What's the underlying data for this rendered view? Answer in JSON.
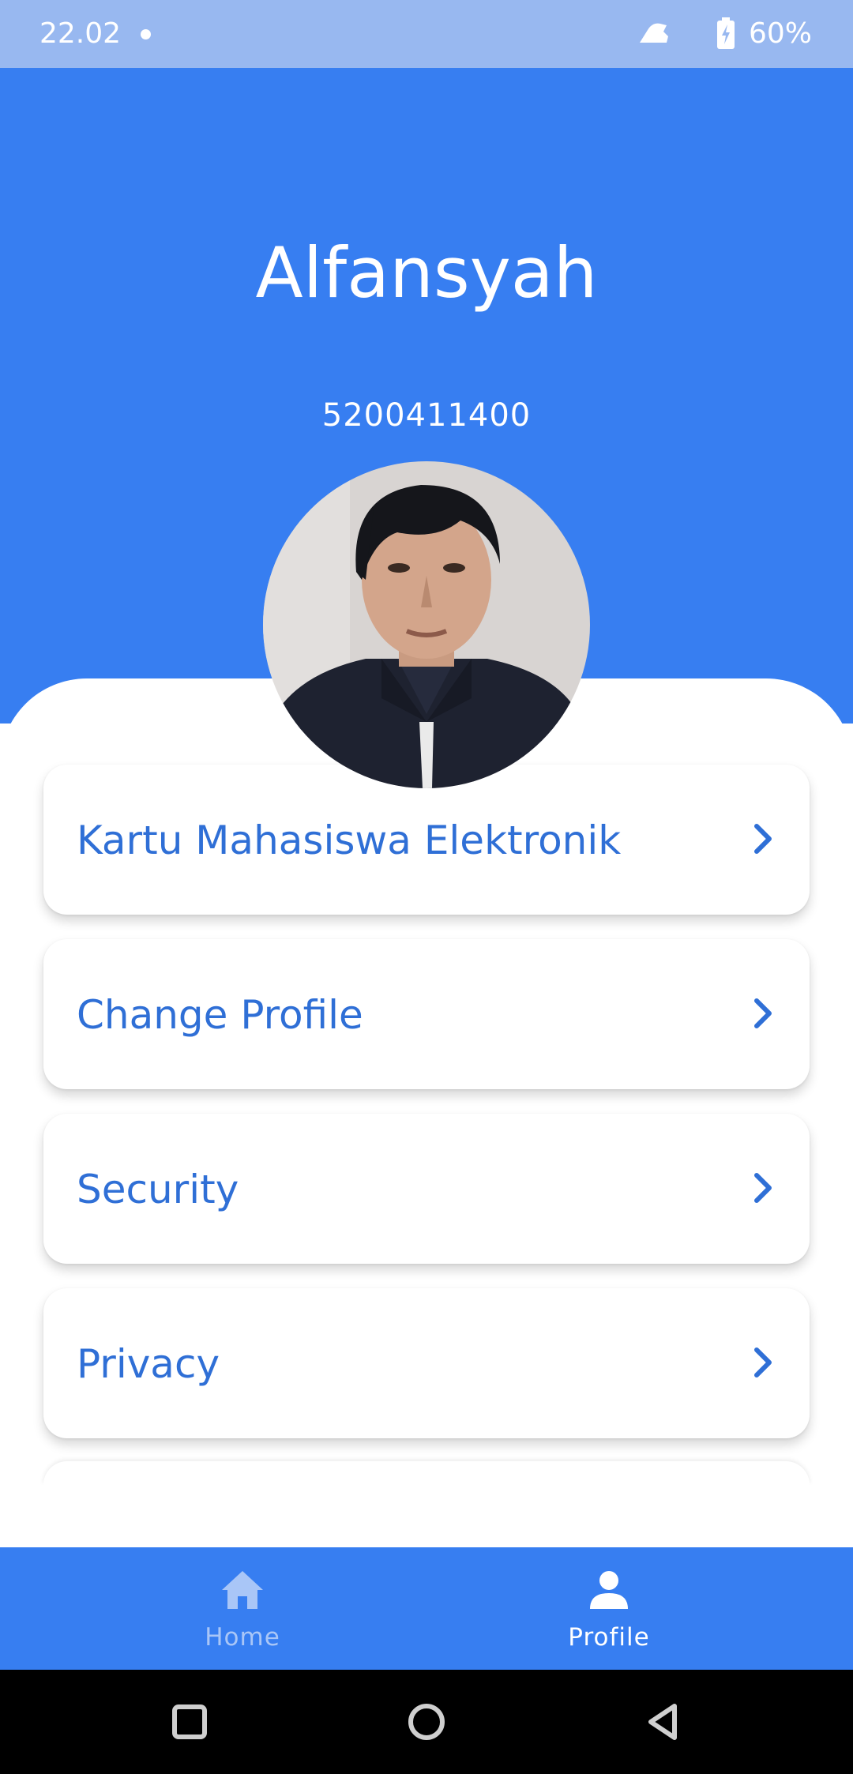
{
  "status_bar": {
    "time": "22.02",
    "battery": "60%",
    "icons": [
      "notification-dot",
      "notification-icon",
      "battery-charging-icon"
    ]
  },
  "profile": {
    "name": "Alfansyah",
    "student_id": "5200411400"
  },
  "menu": {
    "items": [
      {
        "label": "Kartu Mahasiswa Elektronik"
      },
      {
        "label": "Change Profile"
      },
      {
        "label": "Security"
      },
      {
        "label": "Privacy"
      }
    ]
  },
  "bottom_nav": {
    "items": [
      {
        "label": "Home",
        "icon": "home-icon",
        "selected": false
      },
      {
        "label": "Profile",
        "icon": "person-icon",
        "selected": true
      }
    ]
  },
  "system_nav": {
    "icons": [
      "recents-square-icon",
      "home-circle-icon",
      "back-triangle-icon"
    ]
  },
  "colors": {
    "primary": "#377ef1",
    "status_bar": "#98b8f0",
    "menu_text": "#2f6fd6",
    "nav_inactive": "#a9c6f7"
  }
}
